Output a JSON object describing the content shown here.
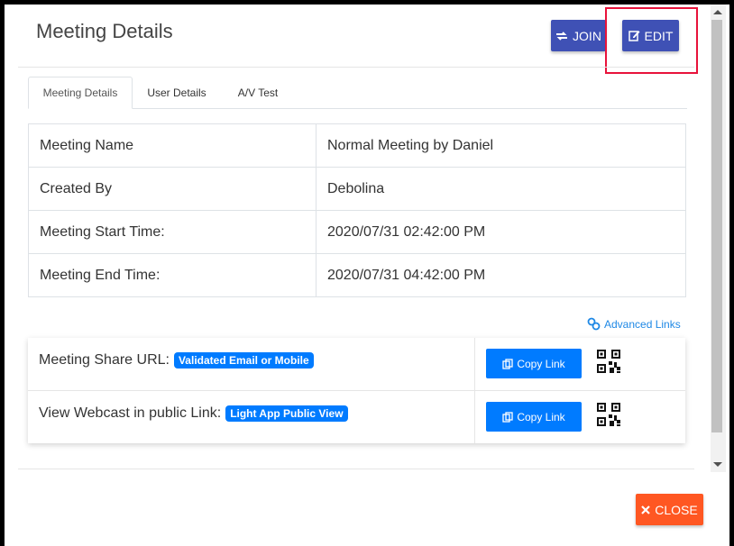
{
  "header": {
    "title": "Meeting Details"
  },
  "actions": {
    "join_label": "JOIN",
    "edit_label": "EDIT",
    "close_label": "CLOSE"
  },
  "tabs": [
    {
      "label": "Meeting Details",
      "active": true
    },
    {
      "label": "User Details",
      "active": false
    },
    {
      "label": "A/V Test",
      "active": false
    }
  ],
  "details": [
    {
      "label": "Meeting Name",
      "value": "Normal Meeting by Daniel"
    },
    {
      "label": "Created By",
      "value": "Debolina"
    },
    {
      "label": "Meeting Start Time:",
      "value": "2020/07/31 02:42:00 PM"
    },
    {
      "label": "Meeting End Time:",
      "value": "2020/07/31 04:42:00 PM"
    }
  ],
  "advanced_links_label": "Advanced Links",
  "share": [
    {
      "label": "Meeting Share URL:",
      "badge": "Validated Email or Mobile",
      "copy_label": "Copy Link",
      "icon": "qr-code-icon"
    },
    {
      "label": "View Webcast in public Link:",
      "badge": "Light App Public View",
      "copy_label": "Copy Link",
      "icon": "qr-code-icon"
    }
  ],
  "colors": {
    "primary": "#3f51b5",
    "link_blue": "#007bff",
    "close_orange": "#ff5722",
    "highlight_red": "#e8133b"
  }
}
